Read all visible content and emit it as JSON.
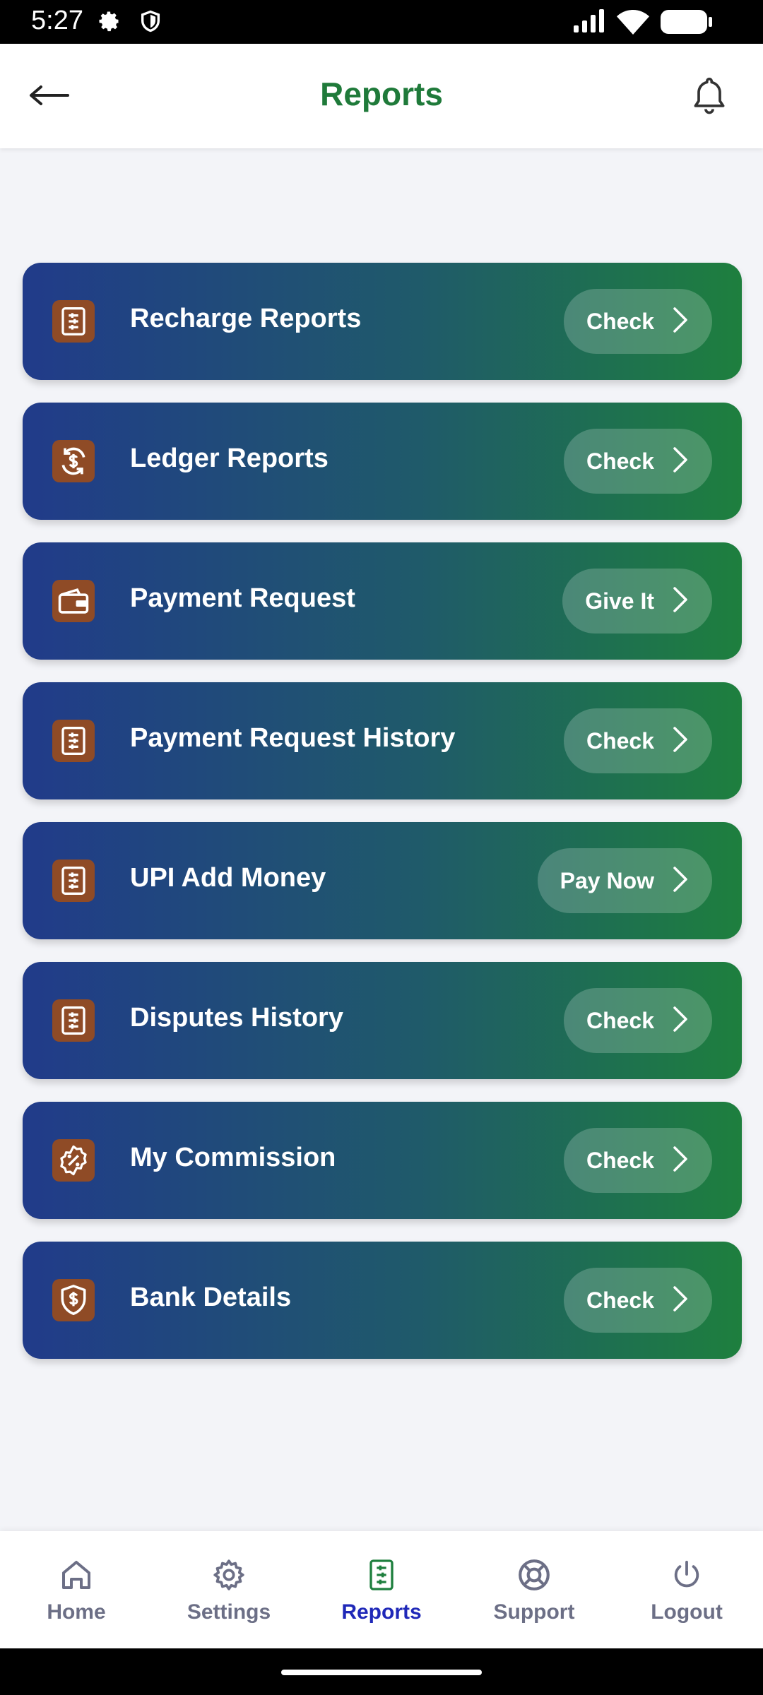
{
  "status_bar": {
    "time": "5:27"
  },
  "header": {
    "title": "Reports"
  },
  "reports": [
    {
      "label": "Recharge Reports",
      "action": "Check",
      "icon": "report-doc-icon"
    },
    {
      "label": "Ledger Reports",
      "action": "Check",
      "icon": "dollar-cycle-icon"
    },
    {
      "label": "Payment Request",
      "action": "Give It",
      "icon": "wallet-icon"
    },
    {
      "label": "Payment Request History",
      "action": "Check",
      "icon": "report-doc-icon"
    },
    {
      "label": "UPI Add Money",
      "action": "Pay Now",
      "icon": "report-doc-icon"
    },
    {
      "label": "Disputes History",
      "action": "Check",
      "icon": "report-doc-icon"
    },
    {
      "label": "My Commission",
      "action": "Check",
      "icon": "percent-badge-icon"
    },
    {
      "label": "Bank Details",
      "action": "Check",
      "icon": "dollar-shield-icon"
    }
  ],
  "bottom_nav": [
    {
      "label": "Home",
      "icon": "home-icon",
      "active": false
    },
    {
      "label": "Settings",
      "icon": "gear-icon",
      "active": false
    },
    {
      "label": "Reports",
      "icon": "report-doc-icon",
      "active": true
    },
    {
      "label": "Support",
      "icon": "lifebuoy-icon",
      "active": false
    },
    {
      "label": "Logout",
      "icon": "power-icon",
      "active": false
    }
  ],
  "colors": {
    "accent_green": "#1f7a3a",
    "card_gradient_start": "#213b8a",
    "card_gradient_end": "#1e7f3e",
    "icon_brown": "#8f4b26",
    "nav_active": "#1f28b8",
    "nav_inactive": "#6c6f86"
  }
}
